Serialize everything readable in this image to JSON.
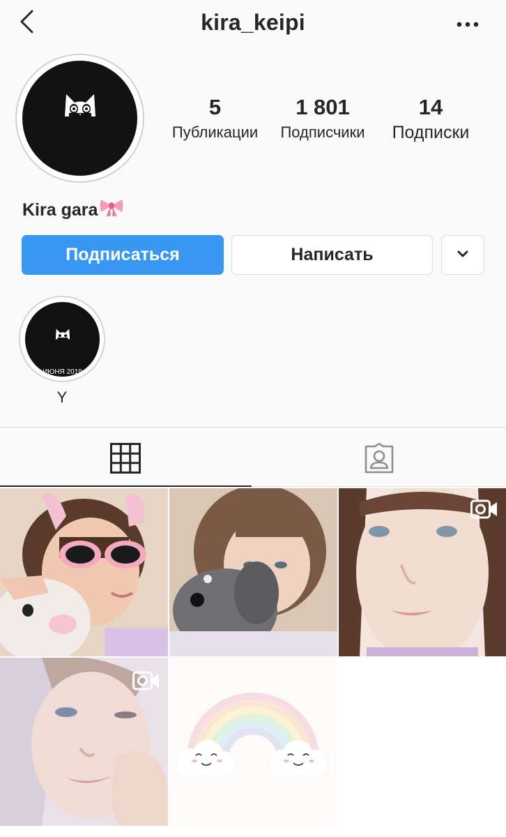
{
  "header": {
    "username": "kira_keipi",
    "back_icon": "chevron-left-icon",
    "more_icon": "more-horizontal-icon"
  },
  "profile": {
    "stats": [
      {
        "value": "5",
        "label": "Публикации"
      },
      {
        "value": "1 801",
        "label": "Подписчики"
      },
      {
        "value": "14",
        "label": "Подписки"
      }
    ],
    "bio_name": "Kira gara"
  },
  "actions": {
    "follow_label": "Подписаться",
    "message_label": "Написать"
  },
  "highlights": [
    {
      "label": "Y",
      "cover_date": "ИЮНЯ 2019"
    }
  ],
  "tabs": [
    "grid-icon",
    "tagged-icon"
  ],
  "posts": [
    {
      "type": "photo"
    },
    {
      "type": "photo"
    },
    {
      "type": "video"
    },
    {
      "type": "video"
    },
    {
      "type": "photo"
    }
  ],
  "colors": {
    "accent": "#3897f0",
    "background": "#fafafa",
    "text": "#262626",
    "border": "#dbdbdb"
  }
}
